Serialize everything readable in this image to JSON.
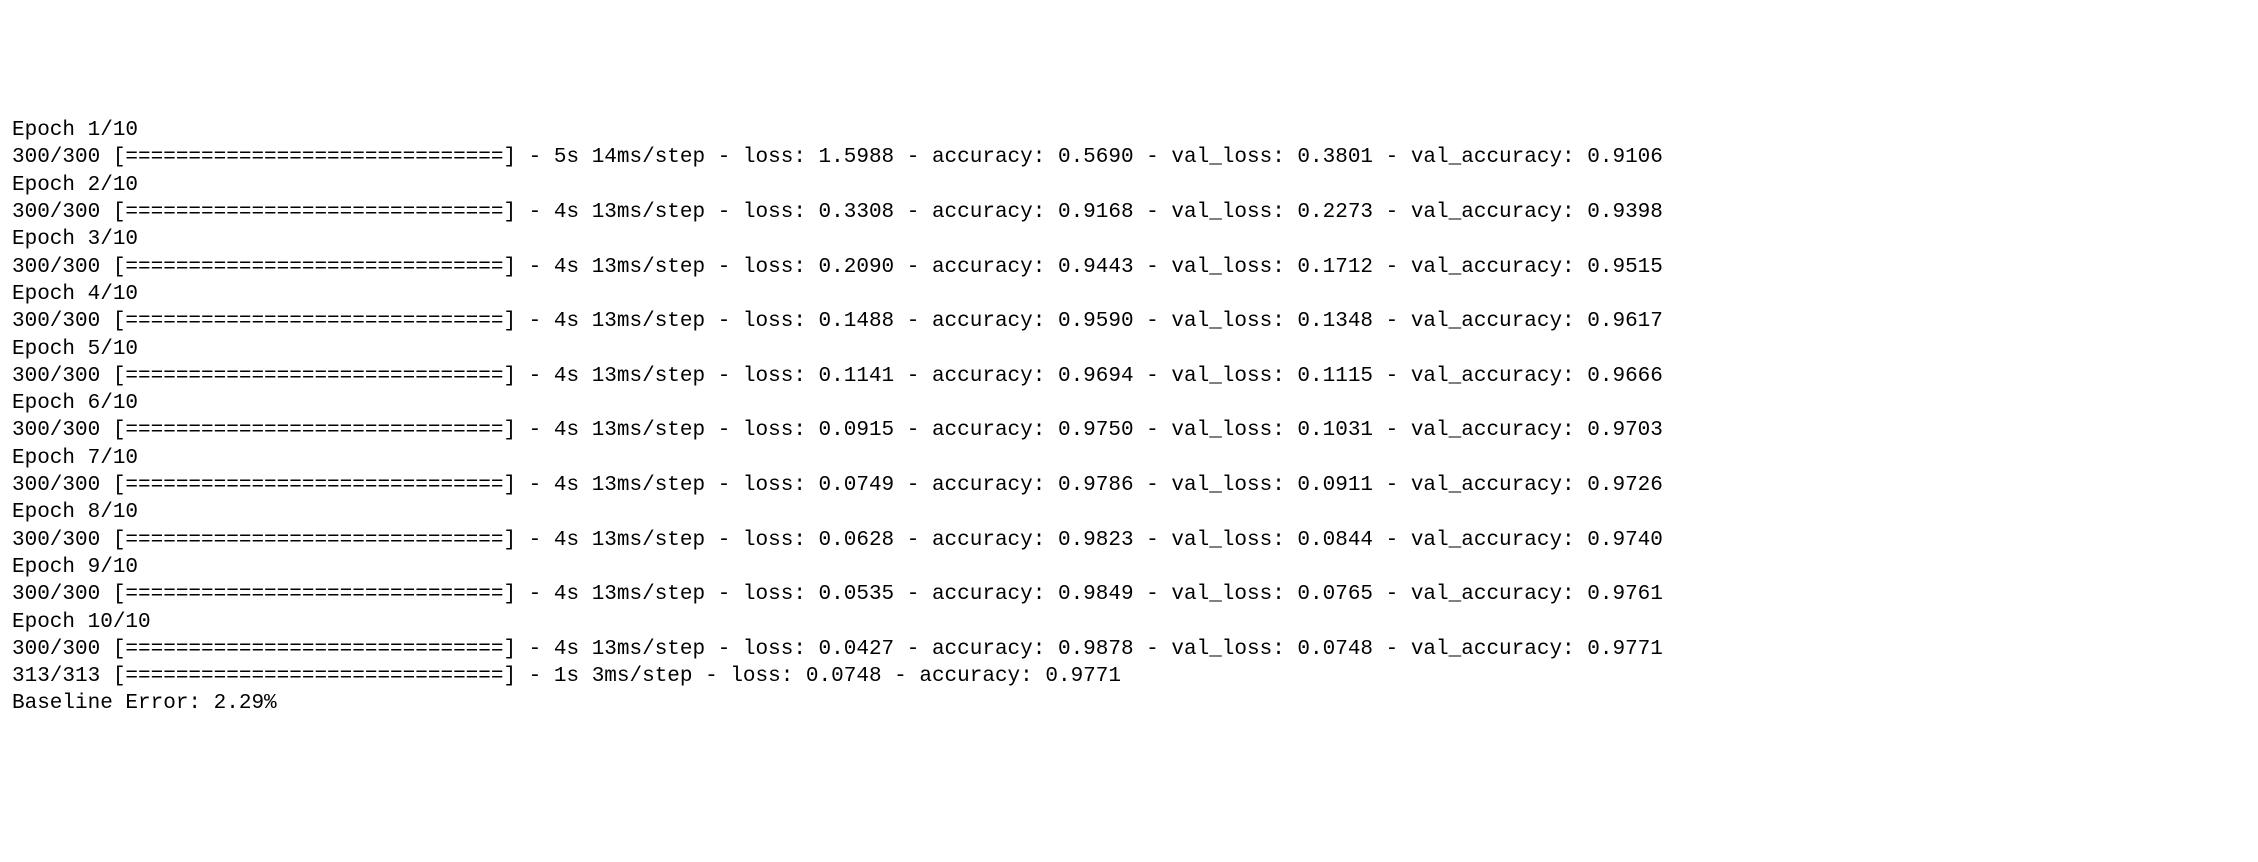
{
  "training": {
    "total_epochs": 10,
    "steps_per_epoch": "300/300",
    "progress_bar": "[==============================]",
    "epochs": [
      {
        "epoch_label": "Epoch 1/10",
        "metrics_line": "300/300 [==============================] - 5s 14ms/step - loss: 1.5988 - accuracy: 0.5690 - val_loss: 0.3801 - val_accuracy: 0.9106"
      },
      {
        "epoch_label": "Epoch 2/10",
        "metrics_line": "300/300 [==============================] - 4s 13ms/step - loss: 0.3308 - accuracy: 0.9168 - val_loss: 0.2273 - val_accuracy: 0.9398"
      },
      {
        "epoch_label": "Epoch 3/10",
        "metrics_line": "300/300 [==============================] - 4s 13ms/step - loss: 0.2090 - accuracy: 0.9443 - val_loss: 0.1712 - val_accuracy: 0.9515"
      },
      {
        "epoch_label": "Epoch 4/10",
        "metrics_line": "300/300 [==============================] - 4s 13ms/step - loss: 0.1488 - accuracy: 0.9590 - val_loss: 0.1348 - val_accuracy: 0.9617"
      },
      {
        "epoch_label": "Epoch 5/10",
        "metrics_line": "300/300 [==============================] - 4s 13ms/step - loss: 0.1141 - accuracy: 0.9694 - val_loss: 0.1115 - val_accuracy: 0.9666"
      },
      {
        "epoch_label": "Epoch 6/10",
        "metrics_line": "300/300 [==============================] - 4s 13ms/step - loss: 0.0915 - accuracy: 0.9750 - val_loss: 0.1031 - val_accuracy: 0.9703"
      },
      {
        "epoch_label": "Epoch 7/10",
        "metrics_line": "300/300 [==============================] - 4s 13ms/step - loss: 0.0749 - accuracy: 0.9786 - val_loss: 0.0911 - val_accuracy: 0.9726"
      },
      {
        "epoch_label": "Epoch 8/10",
        "metrics_line": "300/300 [==============================] - 4s 13ms/step - loss: 0.0628 - accuracy: 0.9823 - val_loss: 0.0844 - val_accuracy: 0.9740"
      },
      {
        "epoch_label": "Epoch 9/10",
        "metrics_line": "300/300 [==============================] - 4s 13ms/step - loss: 0.0535 - accuracy: 0.9849 - val_loss: 0.0765 - val_accuracy: 0.9761"
      },
      {
        "epoch_label": "Epoch 10/10",
        "metrics_line": "300/300 [==============================] - 4s 13ms/step - loss: 0.0427 - accuracy: 0.9878 - val_loss: 0.0748 - val_accuracy: 0.9771"
      }
    ],
    "evaluation_line": "313/313 [==============================] - 1s 3ms/step - loss: 0.0748 - accuracy: 0.9771",
    "baseline_error": "Baseline Error: 2.29%"
  }
}
